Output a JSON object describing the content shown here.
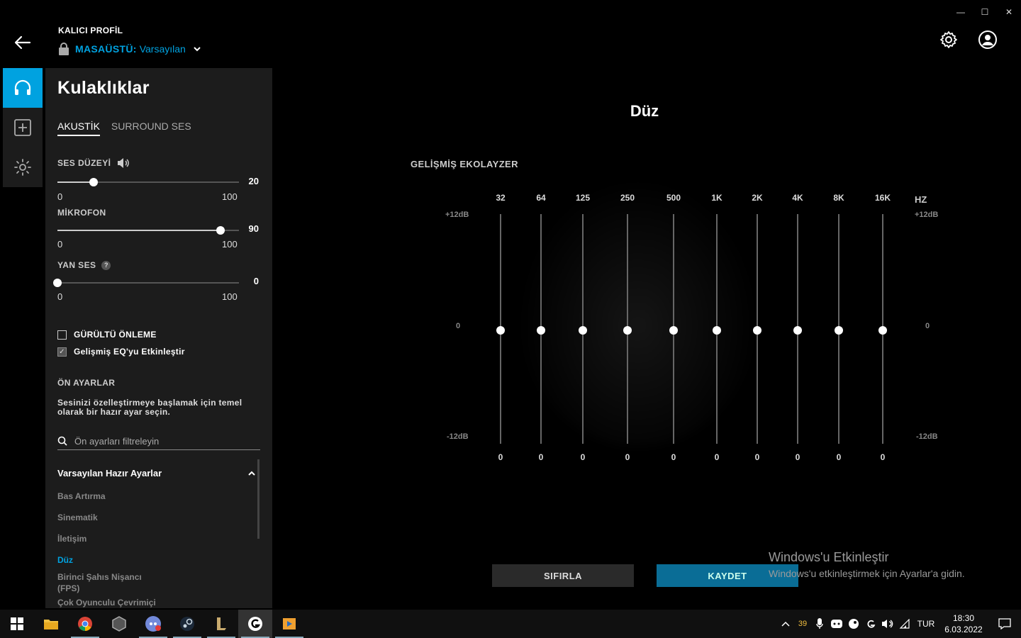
{
  "window": {
    "minimize": "—",
    "maximize": "☐",
    "close": "✕"
  },
  "profile": {
    "title": "KALICI PROFİL",
    "prefix": "MASAÜSTÜ:",
    "name": "Varsayılan"
  },
  "panel": {
    "title": "Kulaklıklar",
    "tabs": [
      {
        "label": "AKUSTİK",
        "active": true
      },
      {
        "label": "SURROUND SES",
        "active": false
      }
    ],
    "volume": {
      "label": "SES DÜZEYİ",
      "value": "20",
      "min": "0",
      "max": "100",
      "level": 0.2
    },
    "mic": {
      "label": "MİKROFON",
      "value": "90",
      "min": "0",
      "max": "100",
      "level": 0.9
    },
    "sidetone": {
      "label": "YAN SES",
      "value": "0",
      "min": "0",
      "max": "100",
      "level": 0.0,
      "help": "?"
    },
    "noise": {
      "label": "GÜRÜLTÜ ÖNLEME",
      "checked": false
    },
    "eq_enable": {
      "label": "Gelişmiş EQ'yu Etkinleştir",
      "checked": true,
      "mark": "✓"
    },
    "presets": {
      "title": "ÖN AYARLAR",
      "description": "Sesinizi özelleştirmeye başlamak için temel olarak bir hazır ayar seçin.",
      "search_placeholder": "Ön ayarları filtreleyin",
      "group_title": "Varsayılan Hazır Ayarlar",
      "items": [
        {
          "label": "Bas Artırma",
          "active": false
        },
        {
          "label": "Sinematik",
          "active": false
        },
        {
          "label": "İletişim",
          "active": false
        },
        {
          "label": "Düz",
          "active": true
        },
        {
          "label": "Birinci Şahıs Nişancı (FPS)",
          "active": false
        },
        {
          "label": "Çok Oyunculu Çevrimiçi",
          "active": false
        }
      ]
    }
  },
  "eq": {
    "preset_title": "Düz",
    "heading": "GELİŞMİŞ EKOLAYZER",
    "hz_label": "HZ",
    "db_top": "+12dB",
    "db_mid": "0",
    "db_bottom": "-12dB",
    "bands": [
      {
        "freq": "32",
        "gain": 0,
        "label": "0"
      },
      {
        "freq": "64",
        "gain": 0,
        "label": "0"
      },
      {
        "freq": "125",
        "gain": 0,
        "label": "0"
      },
      {
        "freq": "250",
        "gain": 0,
        "label": "0"
      },
      {
        "freq": "500",
        "gain": 0,
        "label": "0"
      },
      {
        "freq": "1K",
        "gain": 0,
        "label": "0"
      },
      {
        "freq": "2K",
        "gain": 0,
        "label": "0"
      },
      {
        "freq": "4K",
        "gain": 0,
        "label": "0"
      },
      {
        "freq": "8K",
        "gain": 0,
        "label": "0"
      },
      {
        "freq": "16K",
        "gain": 0,
        "label": "0"
      }
    ],
    "reset_label": "SIFIRLA",
    "save_label": "KAYDET"
  },
  "watermark": {
    "line1": "Windows'u Etkinleştir",
    "line2": "Windows'u etkinleştirmek için Ayarlar'a gidin."
  },
  "taskbar": {
    "tray_badge": "39",
    "lang": "TUR",
    "time": "18:30",
    "date": "6.03.2022"
  },
  "colors": {
    "accent": "#00a2e0",
    "save": "#0a6d96",
    "panel": "#1c1c1c"
  }
}
